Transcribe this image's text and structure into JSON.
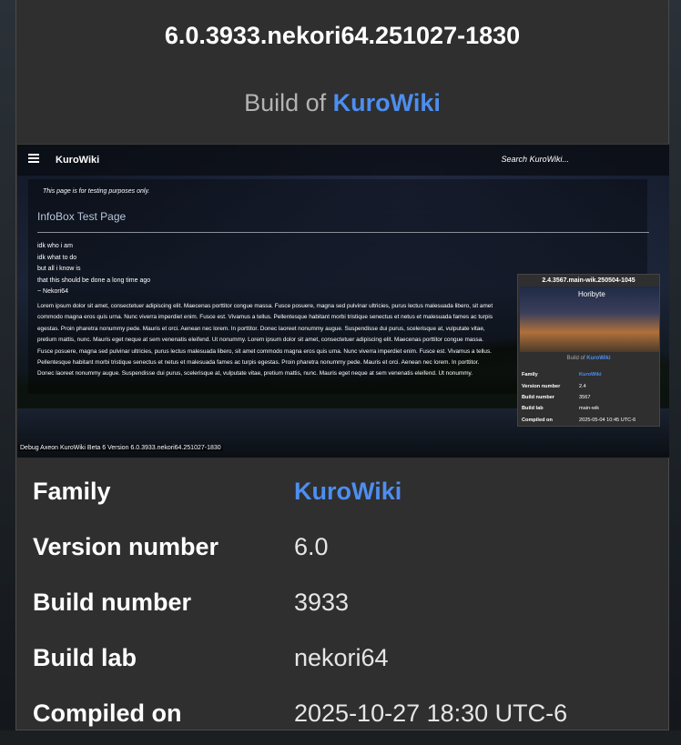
{
  "card": {
    "title": "6.0.3933.nekori64.251027-1830",
    "subtitle_prefix": "Build of",
    "subtitle_link": "KuroWiki"
  },
  "screenshot": {
    "app_name": "KuroWiki",
    "search_placeholder": "Search KuroWiki...",
    "notice": "This page is for testing purposes only.",
    "page_title": "InfoBox Test Page",
    "poem_lines": [
      "idk who i am",
      "idk what to do",
      "but all i know is",
      "that this should be done a long time ago",
      "~ Nekori64"
    ],
    "lorem": "Lorem ipsum dolor sit amet, consectetuer adipiscing elit. Maecenas porttitor congue massa. Fusce posuere, magna sed pulvinar ultricies, purus lectus malesuada libero, sit amet commodo magna eros quis urna. Nunc viverra imperdiet enim. Fusce est. Vivamus a tellus. Pellentesque habitant morbi tristique senectus et netus et malesuada fames ac turpis egestas. Proin pharetra nonummy pede. Mauris et orci. Aenean nec lorem. In porttitor. Donec laoreet nonummy augue. Suspendisse dui purus, scelerisque at, vulputate vitae, pretium mattis, nunc. Mauris eget neque at sem venenatis eleifend. Ut nonummy. Lorem ipsum dolor sit amet, consectetuer adipiscing elit. Maecenas porttitor congue massa. Fusce posuere, magna sed pulvinar ultricies, purus lectus malesuada libero, sit amet commodo magna eros quis urna. Nunc viverra imperdiet enim. Fusce est. Vivamus a tellus. Pellentesque habitant morbi tristique senectus et netus et malesuada fames ac turpis egestas. Proin pharetra nonummy pede. Mauris et orci. Aenean nec lorem. In porttitor. Donec laoreet nonummy augue. Suspendisse dui purus, scelerisque at, vulputate vitae, pretium mattis, nunc. Mauris eget neque at sem venenatis eleifend. Ut nonummy.",
    "mini_infobox": {
      "title": "2.4.3567.main-wik.250504-1045",
      "logo_text": "Horibyte",
      "subtitle_prefix": "Build of",
      "subtitle_link": "KuroWiki",
      "rows": [
        {
          "key": "Family",
          "value": "KuroWiki"
        },
        {
          "key": "Version number",
          "value": "2.4"
        },
        {
          "key": "Build number",
          "value": "3567"
        },
        {
          "key": "Build lab",
          "value": "main-wik"
        },
        {
          "key": "Compiled on",
          "value": "2025-05-04 10:45 UTC-6"
        }
      ]
    },
    "debug_text": "Debug Axeon KuroWiki Beta 6 Version 6.0.3933.nekori64.251027-1830"
  },
  "properties": [
    {
      "key": "Family",
      "value": "KuroWiki"
    },
    {
      "key": "Version number",
      "value": "6.0"
    },
    {
      "key": "Build number",
      "value": "3933"
    },
    {
      "key": "Build lab",
      "value": "nekori64"
    },
    {
      "key": "Compiled on",
      "value": "2025-10-27 18:30 UTC-6"
    }
  ],
  "colors": {
    "card_bg": "#2f2f2f",
    "link": "#4d8ef0",
    "text": "#ffffff"
  }
}
